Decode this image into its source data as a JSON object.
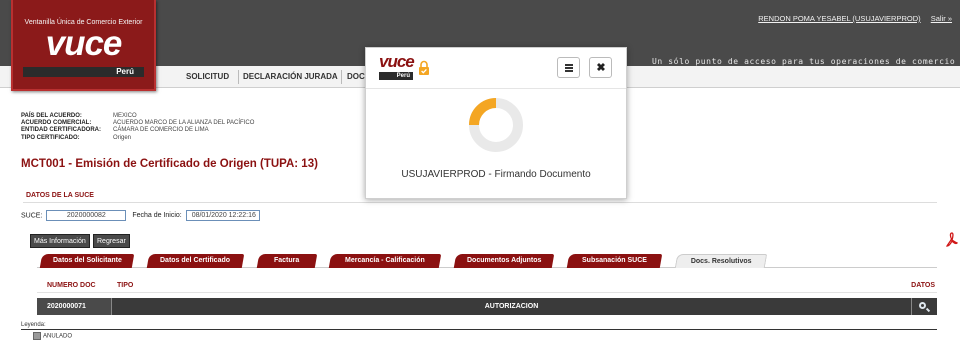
{
  "header": {
    "user_link": "RENDON POMA YESABEL (USUJAVIERPROD)",
    "logout_link": "Salir »",
    "tagline": "Un sólo punto de acceso para tus operaciones de comercio exterior"
  },
  "logo": {
    "top_text": "Ventanilla Única de Comercio Exterior",
    "word": "vuce",
    "country": "Perú"
  },
  "menu": {
    "items": [
      "SOLICITUD",
      "DECLARACIÓN JURADA",
      "DOC"
    ]
  },
  "agreement": {
    "rows": [
      {
        "key": "PAÍS DEL ACUERDO:",
        "value": "MEXICO"
      },
      {
        "key": "ACUERDO COMERCIAL:",
        "value": "ACUERDO MARCO DE LA ALIANZA DEL PACÍFICO"
      },
      {
        "key": "ENTIDAD CERTIFICADORA:",
        "value": "CÁMARA DE COMERCIO DE LIMA"
      },
      {
        "key": "TIPO CERTIFICADO:",
        "value": "Origen"
      }
    ]
  },
  "page": {
    "title": "MCT001 - Emisión de Certificado de Origen (TUPA: 13)",
    "section_title": "DATOS DE LA SUCE"
  },
  "suce": {
    "label": "SUCE:",
    "value": "2020000082",
    "date_label": "Fecha de Inicio:",
    "date_value": "08/01/2020 12:22:16"
  },
  "buttons": {
    "more_info": "Más Información",
    "back": "Regresar"
  },
  "tabs": [
    {
      "label": "Datos del Solicitante"
    },
    {
      "label": "Datos del Certificado"
    },
    {
      "label": "Factura"
    },
    {
      "label": "Mercancía - Calificación"
    },
    {
      "label": "Documentos Adjuntos"
    },
    {
      "label": "Subsanación SUCE"
    },
    {
      "label": "Docs. Resolutivos"
    }
  ],
  "table": {
    "headers": [
      "NUMERO DOC",
      "TIPO",
      "DATOS"
    ],
    "rows": [
      {
        "numero": "2020000071",
        "tipo": "AUTORIZACION"
      }
    ]
  },
  "legend": {
    "label": "Leyenda:",
    "items": [
      "ANULADO"
    ]
  },
  "modal": {
    "logo_word": "vuce",
    "logo_country": "Perú",
    "menu_icon": "hamburger-icon",
    "close_icon": "close-icon",
    "close_glyph": "✖",
    "message": "USUJAVIERPROD - Firmando Documento",
    "spinner_color": "#f4a623"
  },
  "colors": {
    "brand_red": "#8b1111",
    "header_gray": "#4a4a4a",
    "row_dark": "#3a3a3a"
  }
}
